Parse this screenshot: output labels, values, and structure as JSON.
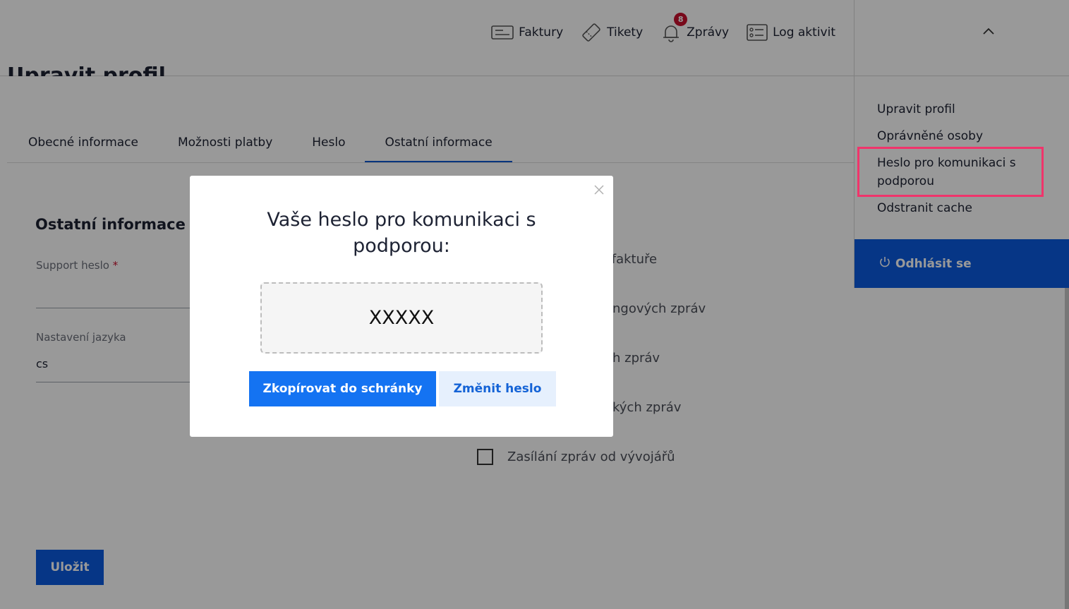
{
  "header": {
    "nav": [
      {
        "label": "Faktury",
        "icon": "invoice-icon"
      },
      {
        "label": "Tikety",
        "icon": "ticket-icon"
      },
      {
        "label": "Zprávy",
        "icon": "bell-icon",
        "badge": "8"
      },
      {
        "label": "Log aktivit",
        "icon": "list-icon"
      }
    ]
  },
  "page": {
    "title": "Upravit profil",
    "tabs": [
      {
        "label": "Obecné informace"
      },
      {
        "label": "Možnosti platby"
      },
      {
        "label": "Heslo"
      },
      {
        "label": "Ostatní informace",
        "active": true
      }
    ],
    "section_title": "Ostatní informace",
    "support_label": "Support heslo",
    "required_mark": "*",
    "language_label": "Nastavení jazyka",
    "language_value": "cs",
    "checkbox_fragments": [
      "a faktuře",
      "ngových zpráv",
      "h zpráv",
      "kých zpráv"
    ],
    "checkbox_last": "Zasílání zpráv od vývojářů",
    "save_label": "Uložit"
  },
  "side": {
    "menu": [
      {
        "label": "Upravit profil"
      },
      {
        "label": "Oprávněné osoby"
      },
      {
        "label": "Heslo pro komunikaci s podporou"
      },
      {
        "label": "Odstranit cache"
      }
    ],
    "logout_label": "Odhlásit se"
  },
  "modal": {
    "title": "Vaše heslo pro komunikaci s podporou:",
    "password": "XXXXX",
    "copy_label": "Zkopírovat do schránky",
    "change_label": "Změnit heslo"
  },
  "colors": {
    "primary": "#0a5be0",
    "highlight_border": "#f0346b",
    "badge": "#c8102e"
  }
}
